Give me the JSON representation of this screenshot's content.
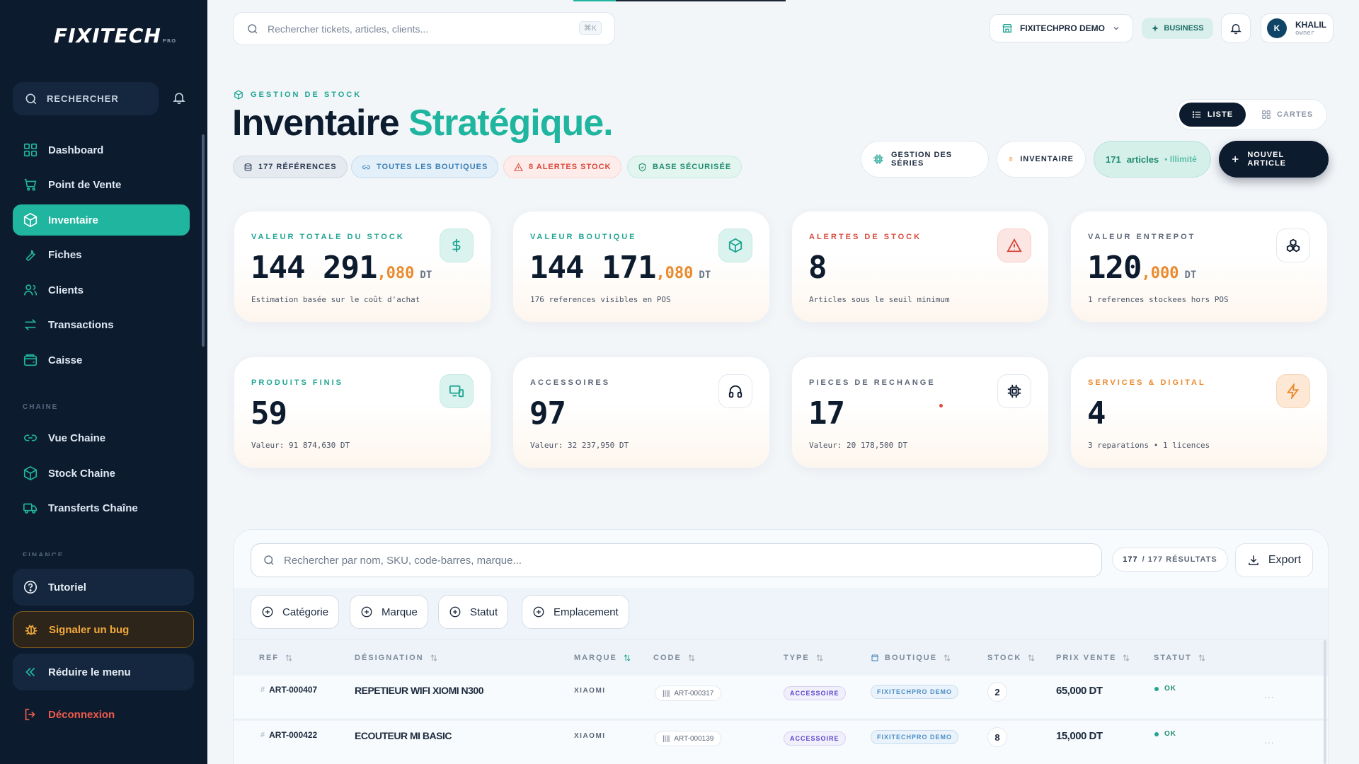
{
  "sidebar": {
    "logo": "FIXITECH",
    "logo_sup": "PRO",
    "search_label": "RECHERCHER",
    "items": [
      {
        "label": "Dashboard",
        "icon": "grid-icon"
      },
      {
        "label": "Point de Vente",
        "icon": "cart-icon"
      },
      {
        "label": "Inventaire",
        "icon": "box-icon"
      },
      {
        "label": "Fiches",
        "icon": "wrench-icon"
      },
      {
        "label": "Clients",
        "icon": "users-icon"
      },
      {
        "label": "Transactions",
        "icon": "swap-icon"
      },
      {
        "label": "Caisse",
        "icon": "wallet-icon"
      }
    ],
    "section_chaine": "CHAINE",
    "chaine_items": [
      {
        "label": "Vue Chaine",
        "icon": "link-icon"
      },
      {
        "label": "Stock Chaine",
        "icon": "box-icon"
      },
      {
        "label": "Transferts Chaîne",
        "icon": "truck-icon"
      }
    ],
    "section_finance": "FINANCE",
    "tutorial": "Tutoriel",
    "report_bug": "Signaler un bug",
    "reduce_menu": "Réduire le menu",
    "logout": "Déconnexion"
  },
  "topbar": {
    "search_placeholder": "Rechercher tickets, articles, clients...",
    "shortcut": "⌘K",
    "shop": "FIXITECHPRO DEMO",
    "plan": "BUSINESS",
    "user_initial": "K",
    "user_name": "KHALIL",
    "user_role": "owner"
  },
  "header": {
    "eyebrow": "GESTION DE STOCK",
    "title_main": "Inventaire",
    "title_accent": "Stratégique.",
    "chips": {
      "refs": "177 RÉFÉRENCES",
      "shops": "TOUTES LES BOUTIQUES",
      "alerts": "8 ALERTES STOCK",
      "secure": "BASE SÉCURISÉE"
    },
    "view_list": "LISTE",
    "view_cards": "CARTES",
    "btn_series": "GESTION DES SÉRIES",
    "btn_inventory": "INVENTAIRE",
    "articles_count": "171",
    "articles_label": "articles",
    "articles_limit": "• Illimité",
    "btn_new": "NOUVEL ARTICLE"
  },
  "stats": [
    {
      "label": "VALEUR TOTALE DU STOCK",
      "value": "144 291",
      "dec": ",080",
      "unit": "DT",
      "sub": "Estimation basée sur le coût d'achat",
      "icon": "dollar-icon",
      "color": "#1fa593"
    },
    {
      "label": "VALEUR BOUTIQUE",
      "value": "144 171",
      "dec": ",080",
      "unit": "DT",
      "sub": "176 references visibles en POS",
      "icon": "box-icon",
      "color": "#1fa593"
    },
    {
      "label": "ALERTES DE STOCK",
      "value": "8",
      "sub": "Articles sous le seuil minimum",
      "icon": "warning-icon",
      "color": "#d9483a"
    },
    {
      "label": "VALEUR ENTREPOT",
      "value": "120",
      "dec": ",000",
      "unit": "DT",
      "sub": "1 references stockees hors POS",
      "icon": "boxes-icon",
      "color": "#5b6678"
    },
    {
      "label": "PRODUITS FINIS",
      "value": "59",
      "sub": "Valeur: 91 874,630 DT",
      "icon": "devices-icon",
      "color": "#1fa593"
    },
    {
      "label": "ACCESSOIRES",
      "value": "97",
      "sub": "Valeur: 32 237,950 DT",
      "icon": "headphones-icon",
      "color": "#5b6678"
    },
    {
      "label": "PIECES DE RECHANGE",
      "value": "17",
      "sub": "Valeur: 20 178,500 DT",
      "icon": "chip-icon",
      "color": "#5b6678"
    },
    {
      "label": "SERVICES & DIGITAL",
      "value": "4",
      "sub": "3 reparations • 1 licences",
      "icon": "bolt-icon",
      "color": "#e98a2d"
    }
  ],
  "table": {
    "search_placeholder": "Rechercher par nom, SKU, code-barres, marque...",
    "results_shown": "177",
    "results_total": "/ 177 RÉSULTATS",
    "export": "Export",
    "filters": [
      "Catégorie",
      "Marque",
      "Statut",
      "Emplacement"
    ],
    "columns": [
      "REF",
      "DÉSIGNATION",
      "MARQUE",
      "CODE",
      "TYPE",
      "BOUTIQUE",
      "STOCK",
      "PRIX VENTE",
      "STATUT"
    ],
    "rows": [
      {
        "ref": "ART-000407",
        "name": "REPETIEUR WIFI XIOMI N300",
        "brand": "XIAOMI",
        "code": "ART-000317",
        "type": "ACCESSOIRE",
        "shop": "FIXITECHPRO DEMO",
        "stock": "2",
        "price": "65,000 DT",
        "status": "OK"
      },
      {
        "ref": "ART-000422",
        "name": "ECOUTEUR MI BASIC",
        "brand": "XIAOMI",
        "code": "ART-000139",
        "type": "ACCESSOIRE",
        "shop": "FIXITECHPRO DEMO",
        "stock": "8",
        "price": "15,000 DT",
        "status": "OK"
      }
    ],
    "more": "..."
  }
}
